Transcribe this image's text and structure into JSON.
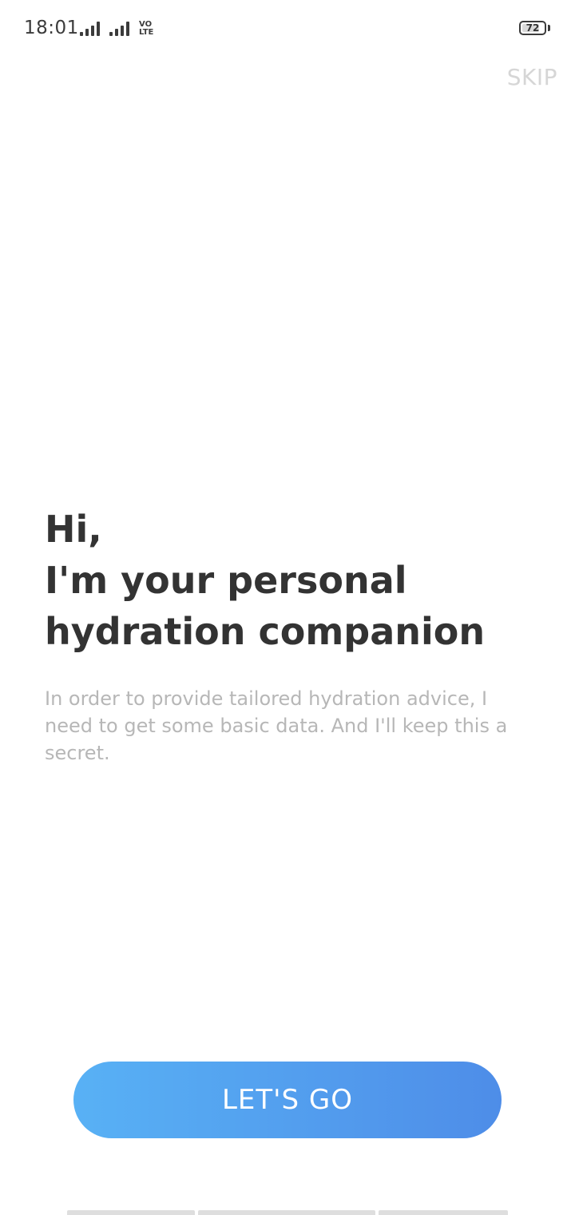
{
  "status_bar": {
    "time": "18:01",
    "volte_line1": "VO",
    "volte_line2": "LTE",
    "battery_level": "72",
    "icons": [
      "signal-icon",
      "signal-icon",
      "volte-icon",
      "battery-icon"
    ]
  },
  "header": {
    "skip_label": "SKIP"
  },
  "intro": {
    "headline_line1": "Hi,",
    "headline_line2": "I'm your personal",
    "headline_line3": "hydration companion",
    "description": "In order to provide tailored hydration advice, I need to get some basic data. And I'll keep this a secret."
  },
  "actions": {
    "primary_label": "LET'S GO"
  },
  "colors": {
    "button_gradient_start": "#58b1f5",
    "button_gradient_end": "#4e8de8",
    "headline": "#333333",
    "description": "#b7b7b7",
    "skip": "#d6d6d6"
  }
}
